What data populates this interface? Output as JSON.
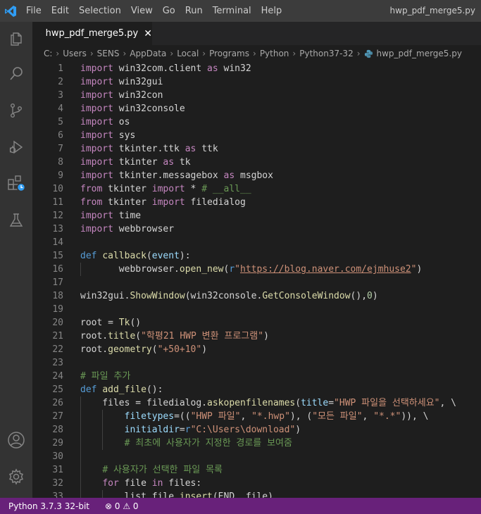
{
  "titlebar": {
    "menu": [
      "File",
      "Edit",
      "Selection",
      "View",
      "Go",
      "Run",
      "Terminal",
      "Help"
    ],
    "window_title": "hwp_pdf_merge5.py"
  },
  "activity_icons": [
    "explorer-icon",
    "search-icon",
    "source-control-icon",
    "run-debug-icon",
    "extensions-icon",
    "testing-icon",
    "account-icon",
    "settings-gear-icon"
  ],
  "tab": {
    "label": "hwp_pdf_merge5.py",
    "close": "✕"
  },
  "breadcrumb": [
    "C:",
    "Users",
    "SENS",
    "AppData",
    "Local",
    "Programs",
    "Python",
    "Python37-32",
    "hwp_pdf_merge5.py"
  ],
  "code_lines": [
    {
      "n": "1",
      "indent": 0,
      "tokens": [
        [
          "kw",
          "import"
        ],
        [
          "tx",
          " win32com.client "
        ],
        [
          "kw",
          "as"
        ],
        [
          "tx",
          " win32"
        ]
      ]
    },
    {
      "n": "2",
      "indent": 0,
      "tokens": [
        [
          "kw",
          "import"
        ],
        [
          "tx",
          " win32gui"
        ]
      ]
    },
    {
      "n": "3",
      "indent": 0,
      "tokens": [
        [
          "kw",
          "import"
        ],
        [
          "tx",
          " win32con"
        ]
      ]
    },
    {
      "n": "4",
      "indent": 0,
      "tokens": [
        [
          "kw",
          "import"
        ],
        [
          "tx",
          " win32console"
        ]
      ]
    },
    {
      "n": "5",
      "indent": 0,
      "tokens": [
        [
          "kw",
          "import"
        ],
        [
          "tx",
          " os"
        ]
      ]
    },
    {
      "n": "6",
      "indent": 0,
      "tokens": [
        [
          "kw",
          "import"
        ],
        [
          "tx",
          " sys"
        ]
      ]
    },
    {
      "n": "7",
      "indent": 0,
      "tokens": [
        [
          "kw",
          "import"
        ],
        [
          "tx",
          " tkinter.ttk "
        ],
        [
          "kw",
          "as"
        ],
        [
          "tx",
          " ttk"
        ]
      ]
    },
    {
      "n": "8",
      "indent": 0,
      "tokens": [
        [
          "kw",
          "import"
        ],
        [
          "tx",
          " tkinter "
        ],
        [
          "kw",
          "as"
        ],
        [
          "tx",
          " tk"
        ]
      ]
    },
    {
      "n": "9",
      "indent": 0,
      "tokens": [
        [
          "kw",
          "import"
        ],
        [
          "tx",
          " tkinter.messagebox "
        ],
        [
          "kw",
          "as"
        ],
        [
          "tx",
          " msgbox"
        ]
      ]
    },
    {
      "n": "10",
      "indent": 0,
      "tokens": [
        [
          "kw",
          "from"
        ],
        [
          "tx",
          " tkinter "
        ],
        [
          "kw",
          "import"
        ],
        [
          "tx",
          " * "
        ],
        [
          "cm",
          "# __all__"
        ]
      ]
    },
    {
      "n": "11",
      "indent": 0,
      "tokens": [
        [
          "kw",
          "from"
        ],
        [
          "tx",
          " tkinter "
        ],
        [
          "kw",
          "import"
        ],
        [
          "tx",
          " filedialog"
        ]
      ]
    },
    {
      "n": "12",
      "indent": 0,
      "tokens": [
        [
          "kw",
          "import"
        ],
        [
          "tx",
          " time"
        ]
      ]
    },
    {
      "n": "13",
      "indent": 0,
      "tokens": [
        [
          "kw",
          "import"
        ],
        [
          "tx",
          " webbrowser"
        ]
      ]
    },
    {
      "n": "14",
      "indent": 0,
      "tokens": []
    },
    {
      "n": "15",
      "indent": 0,
      "tokens": [
        [
          "def",
          "def"
        ],
        [
          "tx",
          " "
        ],
        [
          "fn",
          "callback"
        ],
        [
          "tx",
          "("
        ],
        [
          "pm",
          "event"
        ],
        [
          "tx",
          "):"
        ]
      ]
    },
    {
      "n": "16",
      "indent": 1,
      "tokens": [
        [
          "tx",
          "       webbrowser."
        ],
        [
          "fn",
          "open_new"
        ],
        [
          "tx",
          "("
        ],
        [
          "def",
          "r"
        ],
        [
          "str",
          "\""
        ],
        [
          "url",
          "https://blog.naver.com/ejmhuse2"
        ],
        [
          "str",
          "\""
        ],
        [
          "tx",
          ")"
        ]
      ]
    },
    {
      "n": "17",
      "indent": 0,
      "tokens": []
    },
    {
      "n": "18",
      "indent": 0,
      "tokens": [
        [
          "tx",
          "win32gui."
        ],
        [
          "fn",
          "ShowWindow"
        ],
        [
          "tx",
          "(win32console."
        ],
        [
          "fn",
          "GetConsoleWindow"
        ],
        [
          "tx",
          "(),"
        ],
        [
          "num",
          "0"
        ],
        [
          "tx",
          ")"
        ]
      ]
    },
    {
      "n": "19",
      "indent": 0,
      "tokens": []
    },
    {
      "n": "20",
      "indent": 0,
      "tokens": [
        [
          "tx",
          "root = "
        ],
        [
          "fn",
          "Tk"
        ],
        [
          "tx",
          "()"
        ]
      ]
    },
    {
      "n": "21",
      "indent": 0,
      "tokens": [
        [
          "tx",
          "root."
        ],
        [
          "fn",
          "title"
        ],
        [
          "tx",
          "("
        ],
        [
          "str",
          "\"학평21 HWP 변환 프로그램\""
        ],
        [
          "tx",
          ")"
        ]
      ]
    },
    {
      "n": "22",
      "indent": 0,
      "tokens": [
        [
          "tx",
          "root."
        ],
        [
          "fn",
          "geometry"
        ],
        [
          "tx",
          "("
        ],
        [
          "str",
          "\"+50+10\""
        ],
        [
          "tx",
          ")"
        ]
      ]
    },
    {
      "n": "23",
      "indent": 0,
      "tokens": []
    },
    {
      "n": "24",
      "indent": 0,
      "tokens": [
        [
          "cm",
          "# 파일 추가"
        ]
      ]
    },
    {
      "n": "25",
      "indent": 0,
      "tokens": [
        [
          "def",
          "def"
        ],
        [
          "tx",
          " "
        ],
        [
          "fn",
          "add_file"
        ],
        [
          "tx",
          "():"
        ]
      ]
    },
    {
      "n": "26",
      "indent": 1,
      "tokens": [
        [
          "tx",
          "    files = filedialog."
        ],
        [
          "fn",
          "askopenfilenames"
        ],
        [
          "tx",
          "("
        ],
        [
          "pm",
          "title"
        ],
        [
          "tx",
          "="
        ],
        [
          "str",
          "\"HWP 파일을 선택하세요\""
        ],
        [
          "tx",
          ", \\"
        ]
      ]
    },
    {
      "n": "27",
      "indent": 2,
      "tokens": [
        [
          "tx",
          "        "
        ],
        [
          "pm",
          "filetypes"
        ],
        [
          "tx",
          "=(("
        ],
        [
          "str",
          "\"HWP 파일\""
        ],
        [
          "tx",
          ", "
        ],
        [
          "str",
          "\"*.hwp\""
        ],
        [
          "tx",
          "), ("
        ],
        [
          "str",
          "\"모든 파일\""
        ],
        [
          "tx",
          ", "
        ],
        [
          "str",
          "\"*.*\""
        ],
        [
          "tx",
          ")), \\"
        ]
      ]
    },
    {
      "n": "28",
      "indent": 2,
      "tokens": [
        [
          "tx",
          "        "
        ],
        [
          "pm",
          "initialdir"
        ],
        [
          "tx",
          "="
        ],
        [
          "def",
          "r"
        ],
        [
          "str",
          "\"C:\\Users\\download\""
        ],
        [
          "tx",
          ")"
        ]
      ]
    },
    {
      "n": "29",
      "indent": 2,
      "tokens": [
        [
          "tx",
          "        "
        ],
        [
          "cm",
          "# 최초에 사용자가 지정한 경로를 보여줌"
        ]
      ]
    },
    {
      "n": "30",
      "indent": 1,
      "tokens": []
    },
    {
      "n": "31",
      "indent": 1,
      "tokens": [
        [
          "tx",
          "    "
        ],
        [
          "cm",
          "# 사용자가 선택한 파일 목록"
        ]
      ]
    },
    {
      "n": "32",
      "indent": 1,
      "tokens": [
        [
          "tx",
          "    "
        ],
        [
          "kw",
          "for"
        ],
        [
          "tx",
          " file "
        ],
        [
          "kw",
          "in"
        ],
        [
          "tx",
          " files:"
        ]
      ]
    },
    {
      "n": "33",
      "indent": 2,
      "tokens": [
        [
          "tx",
          "        list_file."
        ],
        [
          "fn",
          "insert"
        ],
        [
          "tx",
          "(END, file)"
        ]
      ]
    }
  ],
  "statusbar": {
    "python": "Python 3.7.3 32-bit",
    "problems": "⊗ 0 ⚠ 0"
  },
  "colors": {
    "statusbar": "#68217a",
    "accent_blue": "#007acc"
  }
}
